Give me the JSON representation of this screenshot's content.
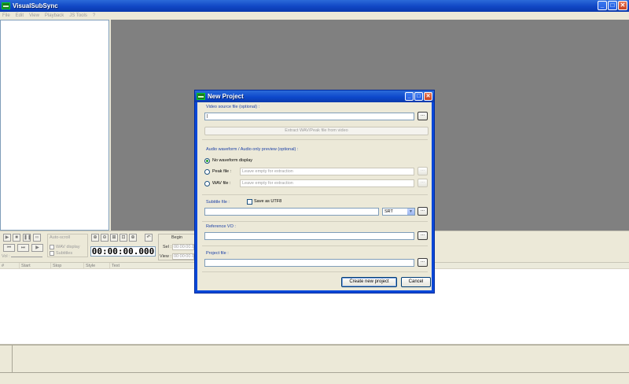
{
  "app": {
    "title": "VisualSubSync",
    "menu": [
      "File",
      "Edit",
      "View",
      "Playback",
      "JS Tools",
      "?"
    ],
    "window_buttons": {
      "minimize": "_",
      "maximize": "□",
      "close": "✕"
    }
  },
  "controls": {
    "auto_scroll": "Auto-scroll",
    "wav_display": "WAV display",
    "subtitles": "Subtitles",
    "vol": "Vol :",
    "timecode": "00:00:00.000",
    "begin": "Begin",
    "sel": "Sel :",
    "view": "View :",
    "sel_value": "00:00:00.0",
    "view_value": "00:00:00.0",
    "play_buttons": [
      "▶",
      "■",
      "❚❚",
      "∞",
      "⏮",
      "⏭",
      "▶"
    ],
    "zoom_buttons": [
      "⊕",
      "⊖",
      "⊞",
      "⊡",
      "⊕"
    ]
  },
  "list": {
    "columns": [
      "#",
      "Start",
      "Stop",
      "Style",
      "Text"
    ]
  },
  "dialog": {
    "title": "New Project",
    "video_group": "Video source file (optional) :",
    "video_value": "|",
    "extract_button": "Extract WAV/Peak file from video",
    "audio_group": "Audio waveform / Audio only preview (optional) :",
    "no_waveform": "No waveform display",
    "peak_file": "Peak file :",
    "peak_placeholder": "Leave empty for extraction",
    "wav_file": "WAV file :",
    "wav_placeholder": "Leave empty for extraction",
    "subtitle_group": "Subtitle file :",
    "save_utf8": "Save as UTF8",
    "format_selected": "SRT",
    "reference_group": "Reference VO :",
    "project_group": "Project file :",
    "browse": "...",
    "create_button": "Create new project",
    "cancel_button": "Cancel"
  }
}
